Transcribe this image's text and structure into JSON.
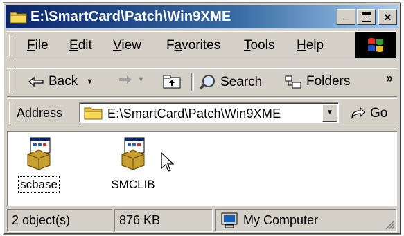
{
  "window": {
    "title": "E:\\SmartCard\\Patch\\Win9XME"
  },
  "titlebar_buttons": {
    "minimize": "_",
    "maximize": "□",
    "close": "✕"
  },
  "menu": [
    {
      "label": "File",
      "u": "F",
      "rest": "ile"
    },
    {
      "label": "Edit",
      "u": "E",
      "rest": "dit"
    },
    {
      "label": "View",
      "u": "V",
      "rest": "iew"
    },
    {
      "label": "Favorites",
      "pre": "F",
      "u": "a",
      "rest": "vorites"
    },
    {
      "label": "Tools",
      "u": "T",
      "rest": "ools"
    },
    {
      "label": "Help",
      "u": "H",
      "rest": "elp"
    }
  ],
  "menu_labels": {
    "file_u": "F",
    "file_r": "ile",
    "edit_u": "E",
    "edit_r": "dit",
    "view_u": "V",
    "view_r": "iew",
    "fav_p": "F",
    "fav_u": "a",
    "fav_r": "vorites",
    "tools_u": "T",
    "tools_r": "ools",
    "help_u": "H",
    "help_r": "elp"
  },
  "toolbar": {
    "back": "Back",
    "search": "Search",
    "folders": "Folders",
    "more": "»"
  },
  "address": {
    "label_pre": "A",
    "label_u": "d",
    "label_rest": "dress",
    "value": "E:\\SmartCard\\Patch\\Win9XME",
    "go": "Go"
  },
  "files": [
    {
      "name": "scbase",
      "selected": true
    },
    {
      "name": "SMCLIB",
      "selected": false
    }
  ],
  "status": {
    "objects": "2 object(s)",
    "size": "876 KB",
    "zone": "My Computer"
  },
  "colors": {
    "title_start": "#0a246a",
    "title_end": "#a6caf0",
    "face": "#d4d0c8"
  }
}
